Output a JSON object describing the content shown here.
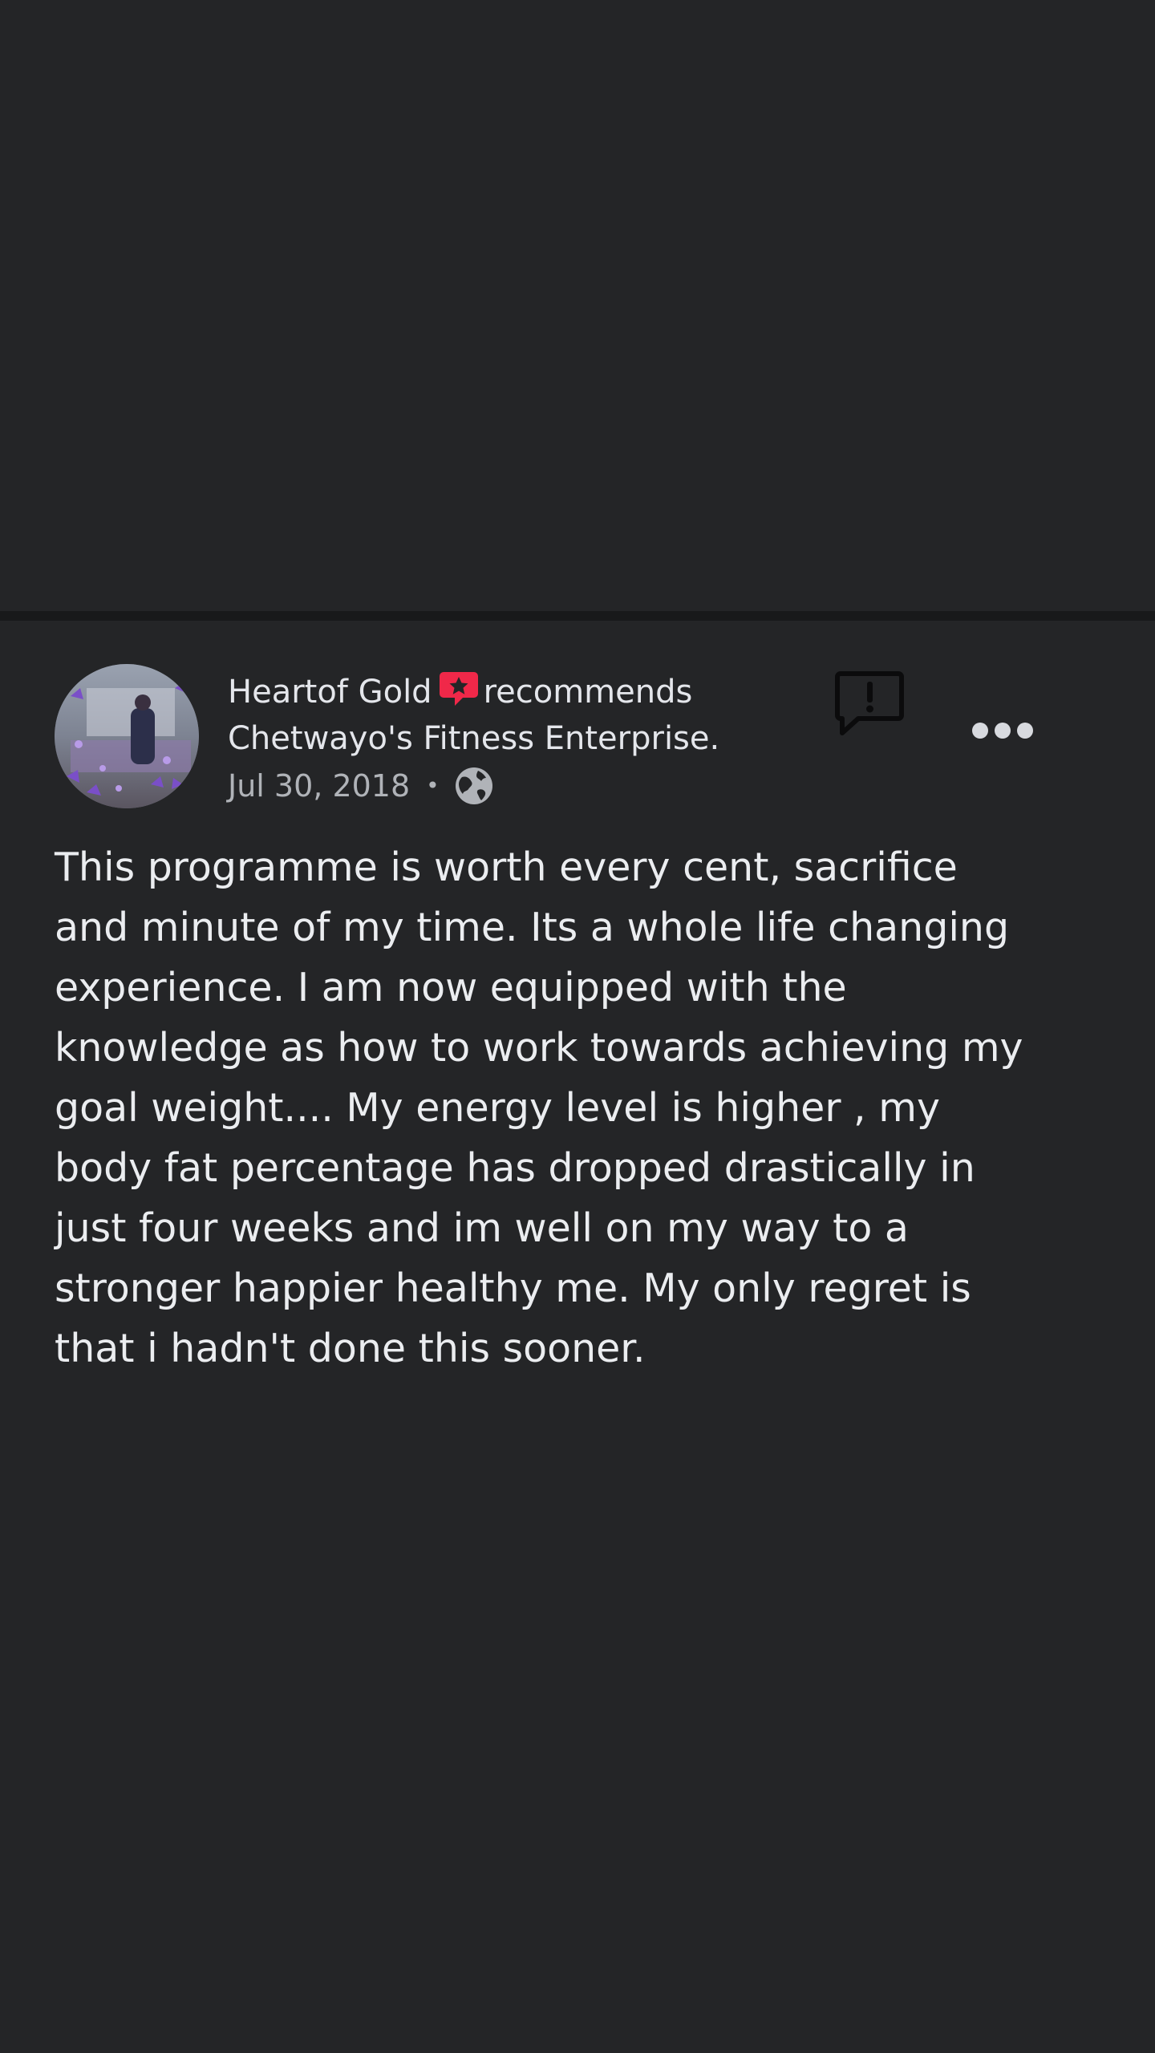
{
  "post": {
    "author": "Heartof Gold",
    "action": "recommends",
    "page_name": "Chetwayo's Fitness Enterprise.",
    "date": "Jul 30, 2018",
    "separator": "•",
    "body": "This programme is worth every cent, sacrifice\nand minute of my time. Its a whole life changing\nexperience. I am now equipped  with the\nknowledge  as how to work towards achieving my\ngoal weight.... My energy level is higher , my\nbody fat percentage has dropped drastically in\njust four weeks and im well on my way to a\nstronger happier healthy me. My only regret is\nthat i hadn't done this sooner."
  },
  "icons": {
    "recommend": "recommend-star-bubble-icon",
    "privacy": "globe-icon",
    "report": "report-exclamation-bubble-icon",
    "more": "more-options-icon"
  },
  "colors": {
    "background": "#242527",
    "divider": "#18191a",
    "recommend_badge": "#f02849",
    "text_primary": "#e4e6eb",
    "text_secondary": "#b0b3b8"
  }
}
